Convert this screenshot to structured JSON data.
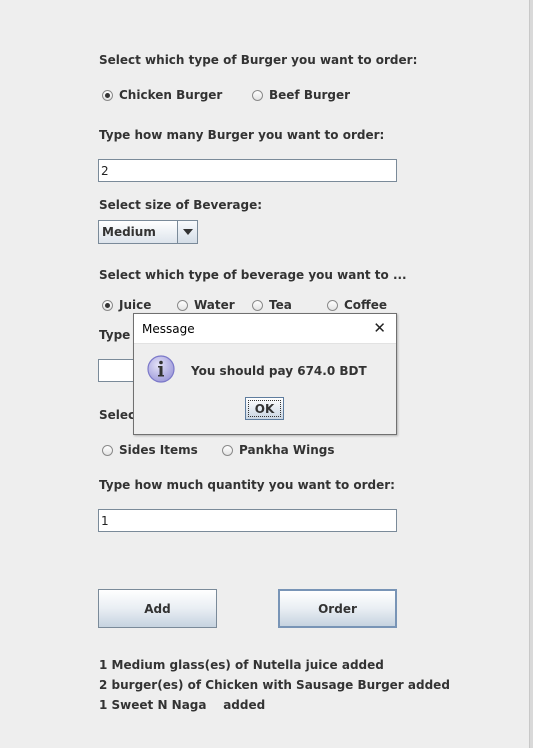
{
  "burger": {
    "type_label": "Select which type of Burger you want to order:",
    "options": [
      "Chicken Burger",
      "Beef Burger"
    ],
    "selected": "Chicken Burger",
    "qty_label": "Type how many Burger you want to order:",
    "qty_value": "2"
  },
  "beverage": {
    "size_label": "Select size of Beverage:",
    "size_value": "Medium",
    "type_label": "Select which type of beverage you want to ...",
    "options": [
      "Juice",
      "Water",
      "Tea",
      "Coffee"
    ],
    "selected": "Juice",
    "qty_label_partial": "Type h"
  },
  "sides": {
    "label_partial": "Select",
    "options": [
      "Sides Items",
      "Pankha Wings"
    ],
    "qty_label": "Type how much quantity you want to order:",
    "qty_value": "1"
  },
  "buttons": {
    "add": "Add",
    "order": "Order"
  },
  "status_lines": [
    "1 Medium glass(es) of Nutella juice added",
    "2 burger(es) of Chicken with Sausage Burger added",
    "1 Sweet N Naga    added"
  ],
  "dialog": {
    "title": "Message",
    "message": "You should pay 674.0 BDT",
    "ok": "OK",
    "close_glyph": "✕"
  },
  "colors": {
    "background": "#eeeeee",
    "button_border": "#7a8a99",
    "info_icon": "#7b78c9"
  }
}
